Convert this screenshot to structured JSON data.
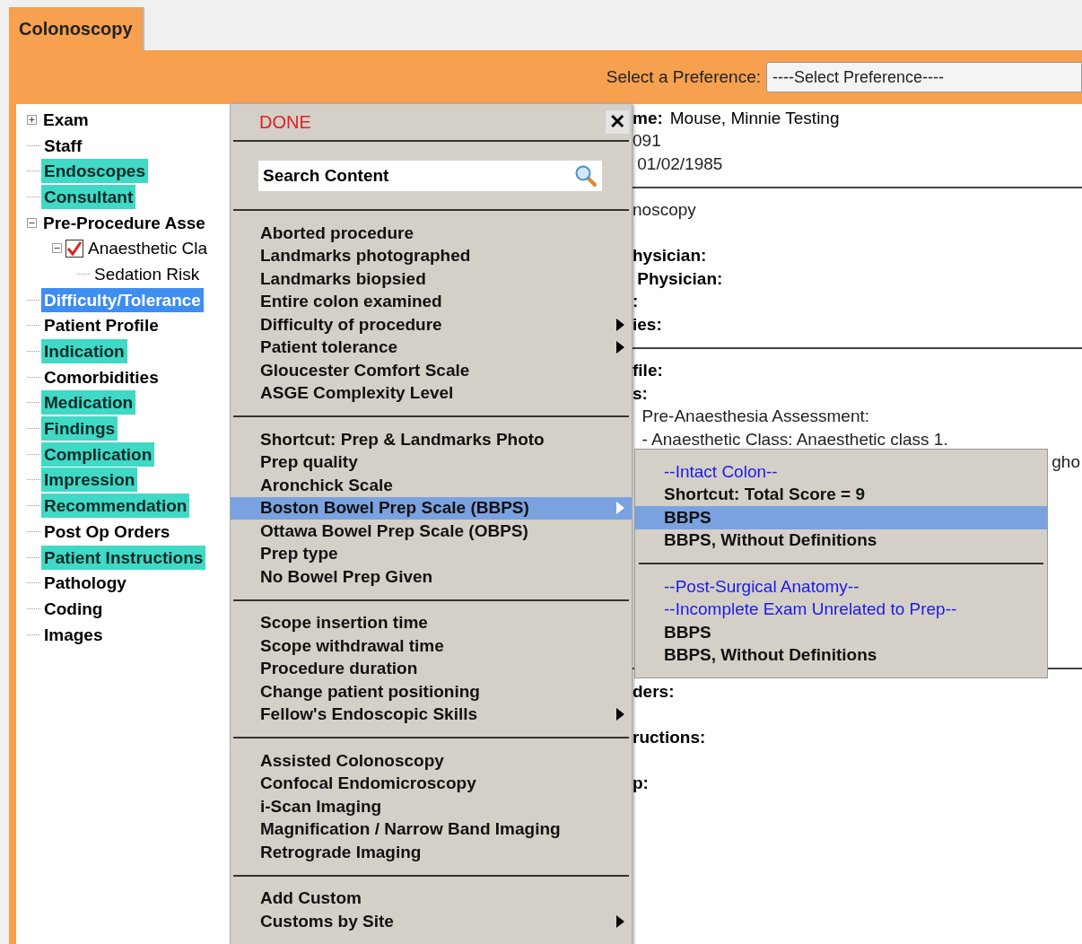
{
  "tabs": [
    {
      "label": "Colonoscopy",
      "selected": true
    }
  ],
  "preference": {
    "label": "Select a Preference:",
    "value": "----Select Preference----"
  },
  "tree": [
    {
      "label": "Exam",
      "expanded": false,
      "highlighted": false,
      "selected": false,
      "bold": true
    },
    {
      "label": "Staff",
      "highlighted": false,
      "selected": false,
      "bold": true
    },
    {
      "label": "Endoscopes",
      "highlighted": true,
      "selected": false,
      "bold": true
    },
    {
      "label": "Consultant",
      "highlighted": true,
      "selected": false,
      "bold": true
    },
    {
      "label": "Pre-Procedure Asse",
      "expanded": true,
      "highlighted": false,
      "selected": false,
      "bold": true,
      "children": [
        {
          "label": "Anaesthetic Cla",
          "expanded": true,
          "checked": true,
          "highlighted": false,
          "selected": false,
          "bold": false,
          "children": [
            {
              "label": "Sedation Risk",
              "highlighted": false,
              "selected": false,
              "bold": false
            }
          ]
        }
      ]
    },
    {
      "label": "Difficulty/Tolerance",
      "selected": true,
      "bold": true
    },
    {
      "label": "Patient Profile",
      "highlighted": false,
      "selected": false,
      "bold": true
    },
    {
      "label": "Indication",
      "highlighted": true,
      "selected": false,
      "bold": true
    },
    {
      "label": "Comorbidities",
      "highlighted": false,
      "selected": false,
      "bold": true
    },
    {
      "label": "Medication",
      "highlighted": true,
      "selected": false,
      "bold": true
    },
    {
      "label": "Findings",
      "highlighted": true,
      "selected": false,
      "bold": true
    },
    {
      "label": "Complication",
      "highlighted": true,
      "selected": false,
      "bold": true
    },
    {
      "label": "Impression",
      "highlighted": true,
      "selected": false,
      "bold": true
    },
    {
      "label": "Recommendation",
      "highlighted": true,
      "selected": false,
      "bold": true
    },
    {
      "label": "Post Op Orders",
      "highlighted": false,
      "selected": false,
      "bold": true
    },
    {
      "label": "Patient Instructions",
      "highlighted": true,
      "selected": false,
      "bold": true
    },
    {
      "label": "Pathology",
      "highlighted": false,
      "selected": false,
      "bold": true
    },
    {
      "label": "Coding",
      "highlighted": false,
      "selected": false,
      "bold": true
    },
    {
      "label": "Images",
      "highlighted": false,
      "selected": false,
      "bold": true
    }
  ],
  "record": [
    {
      "kind": "field",
      "label": "me:",
      "value": "Mouse, Minnie Testing"
    },
    {
      "kind": "text",
      "value": "091"
    },
    {
      "kind": "text",
      "value": " 01/02/1985"
    },
    {
      "kind": "rule"
    },
    {
      "kind": "text",
      "value": "noscopy"
    },
    {
      "kind": "gap"
    },
    {
      "kind": "label",
      "value": "hysician:"
    },
    {
      "kind": "label",
      "value": " Physician:"
    },
    {
      "kind": "label",
      "value": ":"
    },
    {
      "kind": "label",
      "value": "ies:"
    },
    {
      "kind": "rule"
    },
    {
      "kind": "label",
      "value": "file:"
    },
    {
      "kind": "label",
      "value": "s:"
    },
    {
      "kind": "text",
      "value": "  Pre-Anaesthesia Assessment:"
    },
    {
      "kind": "text",
      "value": "  - Anaesthetic Class: Anaesthetic class 1."
    },
    {
      "kind": "tail",
      "value": "gho"
    },
    {
      "kind": "gap"
    },
    {
      "kind": "gap"
    },
    {
      "kind": "gap"
    },
    {
      "kind": "gap"
    },
    {
      "kind": "gap"
    },
    {
      "kind": "gap"
    },
    {
      "kind": "gap"
    },
    {
      "kind": "gap"
    },
    {
      "kind": "rule"
    },
    {
      "kind": "label",
      "value": "ders:"
    },
    {
      "kind": "gap"
    },
    {
      "kind": "label",
      "value": "ructions:"
    },
    {
      "kind": "gap"
    },
    {
      "kind": "label",
      "value": "p:"
    }
  ],
  "menu": {
    "done": "DONE",
    "close": "✕",
    "search": {
      "placeholder": "Search Content"
    },
    "sections": [
      {
        "items": [
          {
            "label": "Aborted procedure",
            "submenu": false,
            "selected": false
          },
          {
            "label": "Landmarks photographed",
            "submenu": false,
            "selected": false
          },
          {
            "label": "Landmarks biopsied",
            "submenu": false,
            "selected": false
          },
          {
            "label": "Entire colon examined",
            "submenu": false,
            "selected": false
          },
          {
            "label": "Difficulty of procedure",
            "submenu": true,
            "selected": false
          },
          {
            "label": "Patient tolerance",
            "submenu": true,
            "selected": false
          },
          {
            "label": "Gloucester Comfort Scale",
            "submenu": false,
            "selected": false
          },
          {
            "label": "ASGE Complexity Level",
            "submenu": false,
            "selected": false
          }
        ]
      },
      {
        "items": [
          {
            "label": "Shortcut: Prep & Landmarks Photo",
            "submenu": false,
            "selected": false
          },
          {
            "label": "Prep quality",
            "submenu": false,
            "selected": false
          },
          {
            "label": "Aronchick Scale",
            "submenu": false,
            "selected": false
          },
          {
            "label": "Boston Bowel Prep Scale (BBPS)",
            "submenu": true,
            "selected": true
          },
          {
            "label": "Ottawa Bowel Prep Scale (OBPS)",
            "submenu": false,
            "selected": false
          },
          {
            "label": "Prep type",
            "submenu": false,
            "selected": false
          },
          {
            "label": "No Bowel Prep Given",
            "submenu": false,
            "selected": false
          }
        ]
      },
      {
        "items": [
          {
            "label": "Scope insertion time",
            "submenu": false,
            "selected": false
          },
          {
            "label": "Scope withdrawal time",
            "submenu": false,
            "selected": false
          },
          {
            "label": "Procedure duration",
            "submenu": false,
            "selected": false
          },
          {
            "label": "Change patient positioning",
            "submenu": false,
            "selected": false
          },
          {
            "label": "Fellow's Endoscopic Skills",
            "submenu": true,
            "selected": false
          }
        ]
      },
      {
        "items": [
          {
            "label": "Assisted Colonoscopy",
            "submenu": false,
            "selected": false
          },
          {
            "label": "Confocal Endomicroscopy",
            "submenu": false,
            "selected": false
          },
          {
            "label": "i-Scan Imaging",
            "submenu": false,
            "selected": false
          },
          {
            "label": "Magnification / Narrow Band Imaging",
            "submenu": false,
            "selected": false
          },
          {
            "label": "Retrograde Imaging",
            "submenu": false,
            "selected": false
          }
        ]
      },
      {
        "items": [
          {
            "label": "Add Custom",
            "submenu": false,
            "selected": false
          },
          {
            "label": "Customs by Site",
            "submenu": true,
            "selected": false
          }
        ]
      }
    ]
  },
  "submenu": {
    "sections": [
      {
        "items": [
          {
            "kind": "heading",
            "label": "--Intact Colon--",
            "selected": false
          },
          {
            "kind": "item",
            "label": "Shortcut: Total Score = 9",
            "selected": false
          },
          {
            "kind": "item",
            "label": "BBPS",
            "selected": true
          },
          {
            "kind": "item",
            "label": "BBPS, Without Definitions",
            "selected": false
          }
        ]
      },
      {
        "items": [
          {
            "kind": "heading",
            "label": "--Post-Surgical Anatomy--",
            "selected": false
          },
          {
            "kind": "heading",
            "label": "--Incomplete Exam Unrelated to Prep--",
            "selected": false
          },
          {
            "kind": "item",
            "label": "BBPS",
            "selected": false
          },
          {
            "kind": "item",
            "label": "BBPS, Without Definitions",
            "selected": false
          }
        ]
      }
    ]
  }
}
